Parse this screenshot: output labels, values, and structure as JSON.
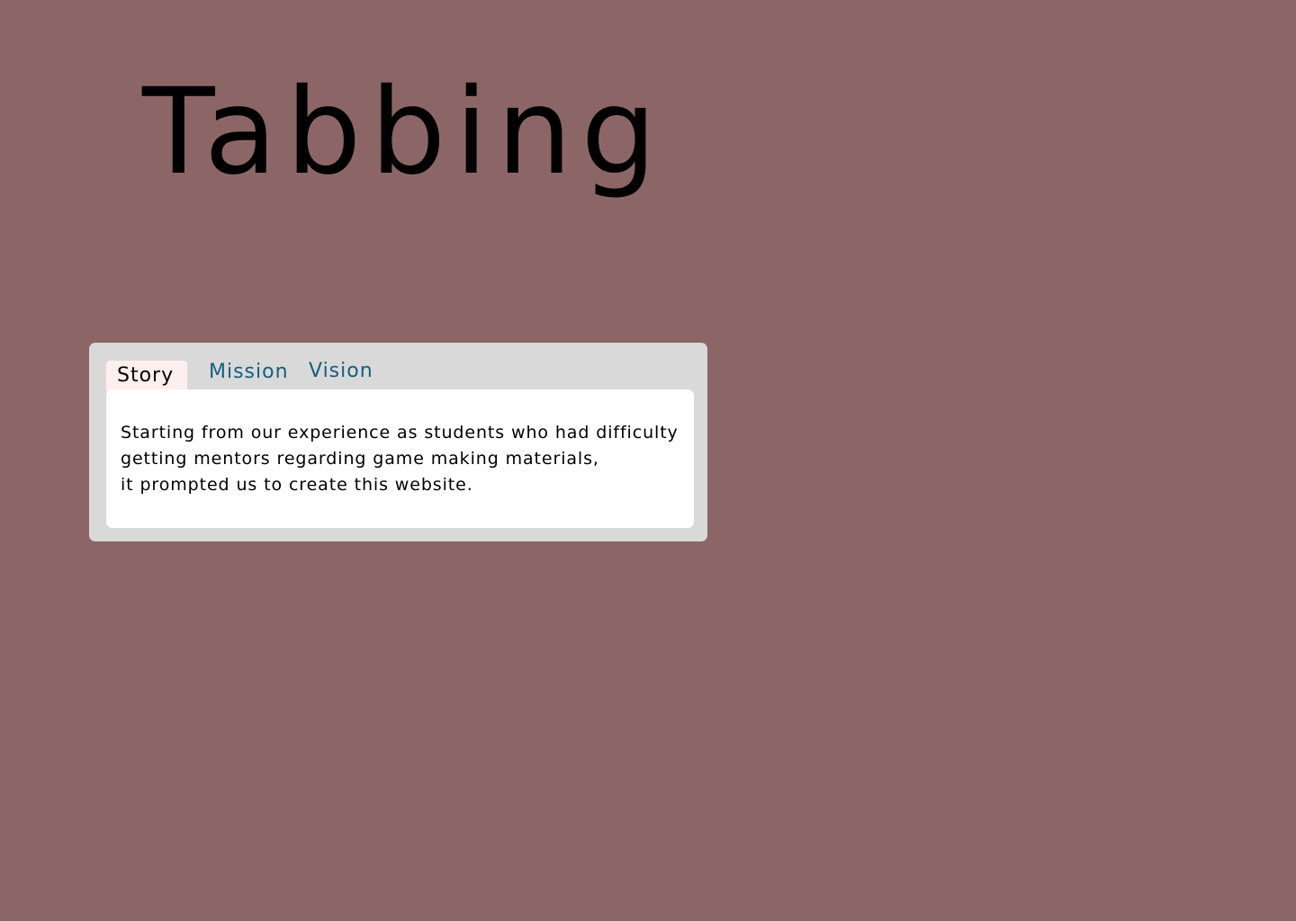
{
  "header": {
    "title": "Tabbing"
  },
  "tabs": {
    "items": [
      {
        "label": "Story",
        "active": true
      },
      {
        "label": "Mission",
        "active": false
      },
      {
        "label": "Vision",
        "active": false
      }
    ],
    "panel": {
      "lines": [
        "Starting from our experience as students who had difficulty",
        "getting mentors regarding game making materials,",
        "it prompted us to create this website."
      ]
    }
  },
  "colors": {
    "page_background": "#8c6667",
    "widget_background": "#d9d9d9",
    "active_tab_background": "#ffeeee",
    "inactive_tab_text": "#125f7c",
    "panel_background": "#ffffff"
  }
}
